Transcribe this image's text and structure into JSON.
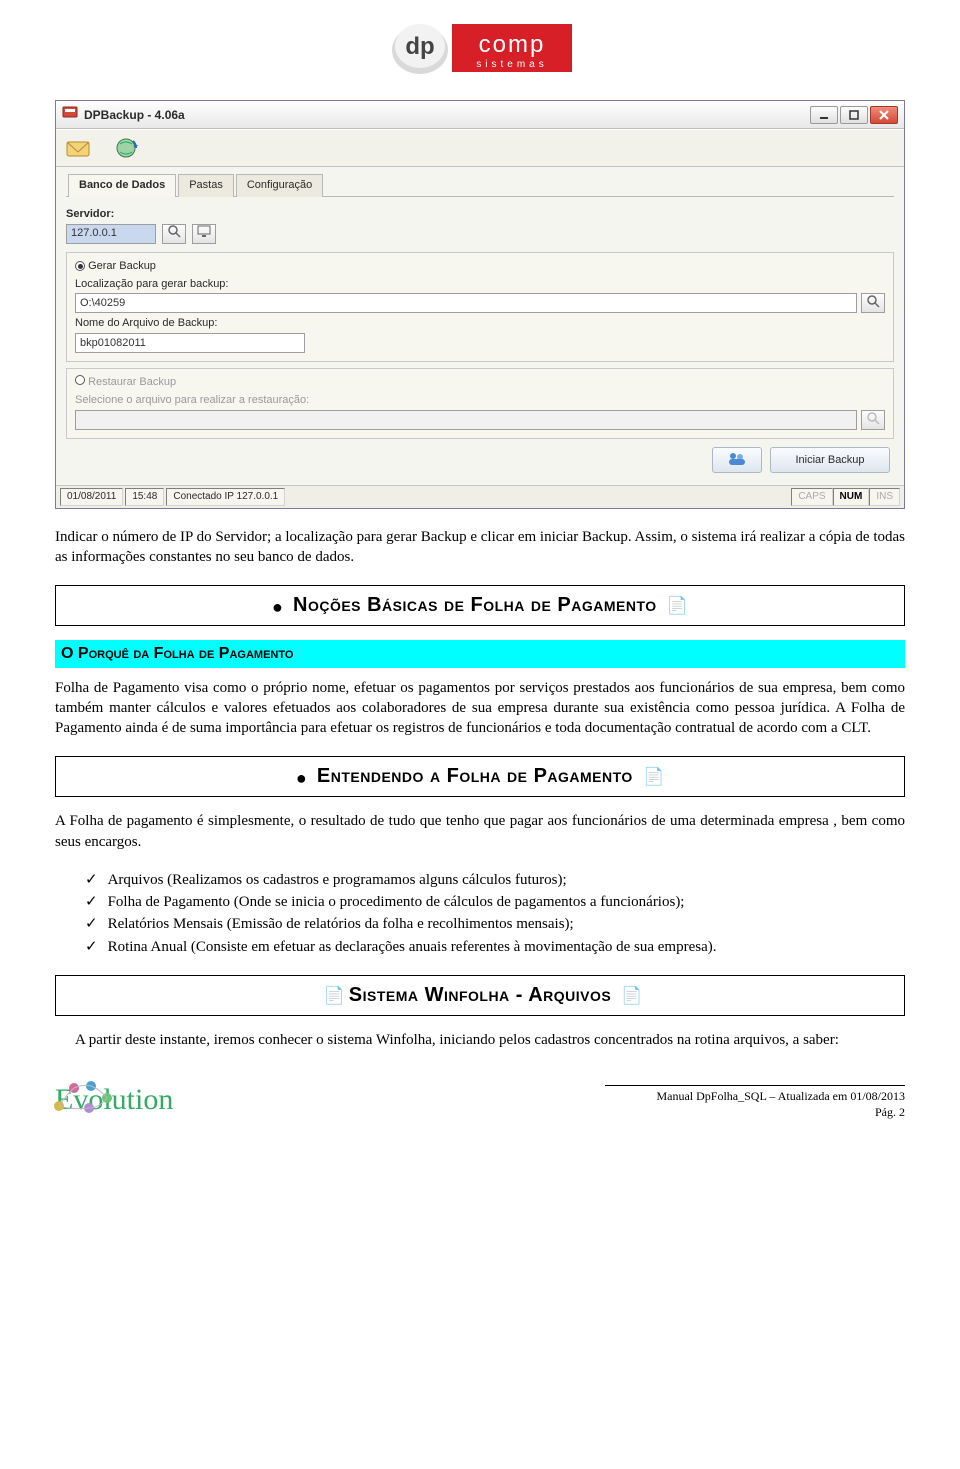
{
  "logo": {
    "brand": "dp",
    "sub": "comp",
    "tagline": "sistemas"
  },
  "window": {
    "title": "DPBackup - 4.06a",
    "tabs": {
      "db": "Banco de Dados",
      "folders": "Pastas",
      "config": "Configuração"
    },
    "server_label": "Servidor:",
    "server_value": "127.0.0.1",
    "gerar": {
      "title": "Gerar Backup",
      "loc_label": "Localização para gerar backup:",
      "loc_value": "O:\\40259",
      "name_label": "Nome do Arquivo de Backup:",
      "name_value": "bkp01082011"
    },
    "restaurar": {
      "title": "Restaurar Backup",
      "hint": "Selecione o arquivo para realizar a restauração:",
      "value": ""
    },
    "start_btn": "Iniciar Backup",
    "status": {
      "date": "01/08/2011",
      "time": "15:48",
      "conn": "Conectado IP 127.0.0.1",
      "caps": "CAPS",
      "num": "NUM",
      "ins": "INS"
    }
  },
  "para1": "Indicar o número de IP do Servidor; a localização para gerar Backup e clicar em iniciar Backup. Assim, o sistema irá realizar a cópia de todas as informações constantes no seu banco de dados.",
  "heading1": "Noções Básicas de Folha de Pagamento",
  "subheading1": "O Porquê da Folha de Pagamento",
  "para2": "Folha de Pagamento visa como o próprio nome, efetuar os pagamentos por serviços prestados aos funcionários de sua empresa, bem como também manter cálculos e valores efetuados aos colaboradores de sua empresa durante sua existência como pessoa jurídica. A Folha de Pagamento ainda é de suma importância para efetuar os registros de funcionários e toda documentação contratual de acordo com a CLT.",
  "heading2": "Entendendo a Folha de Pagamento",
  "para3": "A Folha de pagamento é simplesmente, o resultado de tudo que tenho que pagar aos funcionários de uma determinada empresa , bem como seus encargos.",
  "checklist": [
    "Arquivos (Realizamos os cadastros e programamos alguns cálculos futuros);",
    "Folha de Pagamento (Onde se inicia o procedimento de cálculos de pagamentos a funcionários);",
    "Relatórios Mensais (Emissão de relatórios da folha e recolhimentos mensais);",
    "Rotina Anual (Consiste em efetuar as declarações anuais referentes à movimentação de sua empresa)."
  ],
  "heading3": "Sistema Winfolha - Arquivos",
  "para4": "A partir deste instante, iremos conhecer o sistema Winfolha, iniciando pelos cadastros concentrados na rotina arquivos, a saber:",
  "footer": {
    "line1": "Manual DpFolha_SQL – Atualizada em 01/08/2013",
    "line2": "Pág. 2",
    "evo": "Evolution"
  }
}
